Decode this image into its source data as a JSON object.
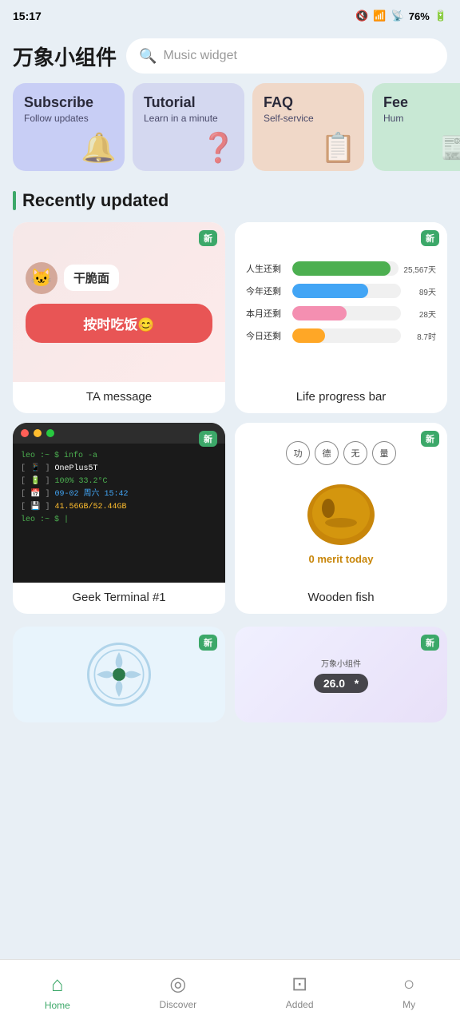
{
  "statusBar": {
    "time": "15:17",
    "battery": "76%",
    "icons": [
      "sim",
      "wifi",
      "signal",
      "battery"
    ]
  },
  "header": {
    "appTitle": "万象小组件",
    "searchPlaceholder": "Music widget"
  },
  "categories": [
    {
      "id": "subscribe",
      "title": "Subscribe",
      "subtitle": "Follow updates",
      "icon": "🔔",
      "colorClass": "subscribe"
    },
    {
      "id": "tutorial",
      "title": "Tutorial",
      "subtitle": "Learn in a minute",
      "icon": "❓",
      "colorClass": "tutorial"
    },
    {
      "id": "faq",
      "title": "FAQ",
      "subtitle": "Self-service",
      "icon": "📋",
      "colorClass": "faq"
    },
    {
      "id": "feed",
      "title": "Fee",
      "subtitle": "Hum",
      "icon": "📰",
      "colorClass": "feed"
    }
  ],
  "sectionTitle": "Recently updated",
  "widgets": [
    {
      "id": "ta-message",
      "label": "TA message",
      "isNew": true,
      "type": "ta-message",
      "preview": {
        "catName": "🐱",
        "personName": "干脆面",
        "message": "按时吃饭😊"
      }
    },
    {
      "id": "life-progress",
      "label": "Life progress bar",
      "isNew": true,
      "type": "life-progress",
      "preview": {
        "rows": [
          {
            "label": "人生还剩",
            "fill": 92,
            "value": "25,567天",
            "color": "green"
          },
          {
            "label": "今年还剩",
            "fill": 70,
            "value": "89天",
            "color": "blue"
          },
          {
            "label": "本月还剩",
            "fill": 50,
            "value": "28天",
            "color": "pink"
          },
          {
            "label": "今日还剩",
            "fill": 30,
            "value": "8.7时",
            "color": "orange"
          }
        ]
      }
    },
    {
      "id": "geek-terminal",
      "label": "Geek Terminal #1",
      "isNew": true,
      "type": "terminal",
      "preview": {
        "lines": [
          {
            "type": "prompt",
            "text": "leo :~ $ info -a"
          },
          {
            "type": "data",
            "key": "[ 📱 ]",
            "val": "OnePlus5T",
            "color": "white"
          },
          {
            "type": "data",
            "key": "[ 🔋 ]",
            "val": "100% 33.2°C",
            "color": "green"
          },
          {
            "type": "data",
            "key": "[ 📅 ]",
            "val": "09-02 周六 15:42",
            "color": "blue"
          },
          {
            "type": "data",
            "key": "[ 💾 ]",
            "val": "41.56GB/52.44GB",
            "color": "yellow"
          },
          {
            "type": "prompt",
            "text": "leo :~ $"
          }
        ]
      }
    },
    {
      "id": "wooden-fish",
      "label": "Wooden fish",
      "isNew": true,
      "type": "wooden-fish",
      "preview": {
        "circles": [
          "功",
          "德",
          "无",
          "量"
        ],
        "meritText": "0 merit today"
      }
    }
  ],
  "partialWidgets": [
    {
      "id": "fan",
      "isNew": true,
      "type": "fan"
    },
    {
      "id": "ac",
      "isNew": true,
      "type": "ac",
      "preview": {
        "brand": "万象小组件",
        "temp": "26.0",
        "unit": "*"
      }
    }
  ],
  "bottomNav": [
    {
      "id": "home",
      "label": "Home",
      "icon": "⌂",
      "active": true
    },
    {
      "id": "discover",
      "label": "Discover",
      "icon": "◎",
      "active": false
    },
    {
      "id": "added",
      "label": "Added",
      "icon": "⊡",
      "active": false
    },
    {
      "id": "my",
      "label": "My",
      "icon": "○",
      "active": false
    }
  ],
  "sysNav": {
    "back": "‹",
    "home": "○",
    "recents": "|||"
  },
  "badgeLabel": "新"
}
